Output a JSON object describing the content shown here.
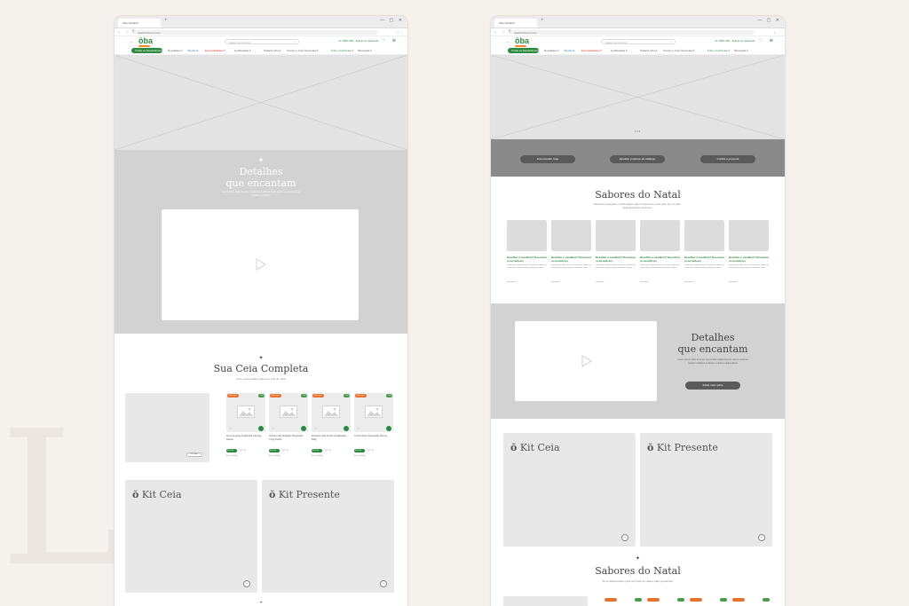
{
  "background": {
    "color": "#f5f1ed",
    "accent_green": "#2d8a3e",
    "accent_orange": "#e8722c",
    "accent_blue": "#2f84c6",
    "accent_red": "#d9352b"
  },
  "browser": {
    "tab_title": "Oba Hortifruti",
    "url": "obahortifruti.com.br",
    "nav_icons": "← → ↻ ⌂",
    "window_controls": "— ▢ ✕",
    "extension_icons": "☆ ⋮"
  },
  "site": {
    "logo": "öba",
    "back_icon": "←",
    "search_placeholder": "Digite sua procura",
    "search_icon": "⌕",
    "phone": "☏ 0800 000 · Entrar ou cadastrar",
    "header_icons": "♡ ⊕",
    "nav": {
      "departments_pill": "Todas os Departamentos ▾",
      "items": [
        "Novidades ▾",
        "Ofertas ▾",
        "Especialidades ▾",
        "Hortifrutiasa ▾",
        "Padaria Oba ▾",
        "Carnes e Frios Especiais ▾",
        "Frios e Laticínios ▾",
        "Mercearia ▾"
      ]
    }
  },
  "left_mockup": {
    "hero_sparkle": "✦",
    "details_title_1": "Detalhes",
    "details_title_2": "que encantam",
    "details_sub": "Lorem ipsum dolor sit amet, consectetur adipiscing elit, sed do eiusmod tempor incididunt ut labore",
    "cesta_sparkle": "✦",
    "cesta_title": "Sua Ceia Completa",
    "cesta_sub": "Itens selecionados para sua ceia de natal",
    "see_all": "Ver todos",
    "products": [
      {
        "badge": "Exclusivo",
        "discount": "-15%",
        "name": "Arroz de Festa Tradicional Oba 1kg Pacote",
        "price": "R$ 9,99",
        "old": "R$ 12,99",
        "unit": "Em 1 un 500g"
      },
      {
        "badge": "Exclusivo",
        "discount": "-15%",
        "name": "Chester Oba Perdigão Temperado 3,1kg Pacote",
        "price": "R$ 9,99",
        "old": "R$ 12,99",
        "unit": "Em 1 un 500g"
      },
      {
        "badge": "Exclusivo",
        "discount": "-15%",
        "name": "Panetone Oba Frutas Cristalizadas 500g",
        "price": "R$ 9,99",
        "old": "R$ 12,99",
        "unit": "Em 1 un 500g"
      },
      {
        "badge": "Exclusivo",
        "discount": "-15%",
        "name": "Lombo Suíno Temperado Oba kg",
        "price": "R$ 9,99",
        "old": "R$ 12,99",
        "unit": "Em 1 un 500g"
      }
    ],
    "kit_ceia": "Kit Ceia",
    "kit_presente": "Kit Presente",
    "bottom_sparkle": "✦"
  },
  "right_mockup": {
    "carousel_dots": "•••",
    "buttons": [
      "Encomendar Ceia",
      "Escolher produtos de catálogo",
      "Confira a proposta"
    ],
    "sabores_title": "Sabores do Natal",
    "sabores_sub": "Receitas especiais e informações para enriquecer a sua ceia, de um jeito deliciosamente exclusivo",
    "info_cards": [
      {
        "title": "Dezeflao é saudável? Descubra os benefícios",
        "desc": "Lorem ipsum dolor sit amet consectetur adipiscing elit sed do eiusmod tempor incididunt ut labore",
        "more": "Leia mais ›"
      },
      {
        "title": "Dezeflao é saudável? Descubra os benefícios",
        "desc": "Lorem ipsum dolor sit amet consectetur adipiscing elit sed do eiusmod tempor incididunt ut labore",
        "more": "Leia mais ›"
      },
      {
        "title": "Dezeflao é saudável? Descubra os benefícios",
        "desc": "Lorem ipsum dolor sit amet consectetur adipiscing elit sed do eiusmod tempor incididunt ut labore",
        "more": "Leia mais ›"
      },
      {
        "title": "Dezeflao é saudável? Descubra os benefícios",
        "desc": "Lorem ipsum dolor sit amet consectetur adipiscing elit sed do eiusmod tempor incididunt ut labore",
        "more": "Leia mais ›"
      },
      {
        "title": "Dezeflao é saudável? Descubra os benefícios",
        "desc": "Lorem ipsum dolor sit amet consectetur adipiscing elit sed do eiusmod tempor incididunt ut labore",
        "more": "Leia mais ›"
      },
      {
        "title": "Dezeflao é saudável? Descubra os benefícios",
        "desc": "Lorem ipsum dolor sit amet consectetur adipiscing elit sed do eiusmod tempor incididunt ut labore",
        "more": "Leia mais ›"
      }
    ],
    "details_title_1": "Detalhes",
    "details_title_2": "que encantam",
    "details_sub": "Lorem ipsum dolor sit amet, consectetur adipiscing elit, sed do eiusmod tempor incididunt ut labore et dolore magna aliqua",
    "details_button": "Saiba mais sobre",
    "kit_ceia": "Kit Ceia",
    "kit_presente": "Kit Presente",
    "bottom_sparkle": "✦",
    "bottom_title": "Sabores do Natal",
    "bottom_sub": "Itens selecionados para sua ceia de natal e para presentear"
  }
}
